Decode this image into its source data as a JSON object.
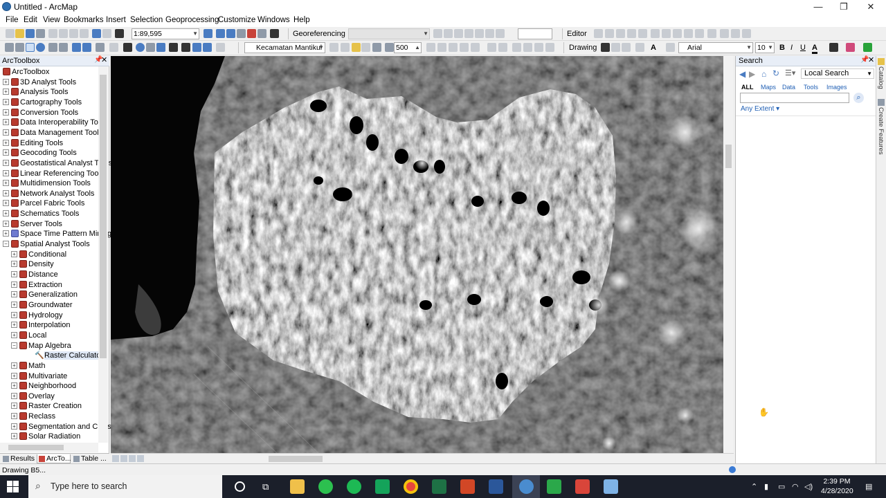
{
  "window": {
    "title": "Untitled - ArcMap",
    "minimize": "—",
    "maximize": "❐",
    "close": "✕"
  },
  "menu": [
    "File",
    "Edit",
    "View",
    "Bookmarks",
    "Insert",
    "Selection",
    "Geoprocessing",
    "Customize",
    "Windows",
    "Help"
  ],
  "toolbar": {
    "scale": "1:89,595",
    "georeferencing_label": "Georeferencing",
    "editor_label": "Editor",
    "layer_combo": "Kecamatan Mantikul",
    "resolution": "500",
    "drawing_label": "Drawing",
    "font_name": "Arial",
    "font_size": "10",
    "bold": "B",
    "italic": "I",
    "underline": "U",
    "font_color_label": "A"
  },
  "arctoolbox": {
    "title": "ArcToolbox",
    "root": "ArcToolbox",
    "toolboxes": [
      "3D Analyst Tools",
      "Analysis Tools",
      "Cartography Tools",
      "Conversion Tools",
      "Data Interoperability Tools",
      "Data Management Tools",
      "Editing Tools",
      "Geocoding Tools",
      "Geostatistical Analyst Tools",
      "Linear Referencing Tools",
      "Multidimension Tools",
      "Network Analyst Tools",
      "Parcel Fabric Tools",
      "Schematics Tools",
      "Server Tools",
      "Space Time Pattern Mining",
      "Spatial Analyst Tools"
    ],
    "spatial_analyst_toolsets": [
      "Conditional",
      "Density",
      "Distance",
      "Extraction",
      "Generalization",
      "Groundwater",
      "Hydrology",
      "Interpolation",
      "Local",
      "Map Algebra",
      "Math",
      "Multivariate",
      "Neighborhood",
      "Overlay",
      "Raster Creation",
      "Reclass",
      "Segmentation and Classification",
      "Solar Radiation"
    ],
    "map_algebra_tool": "Raster Calculator",
    "tabs": [
      "Results",
      "ArcTo...",
      "Table ..."
    ]
  },
  "search": {
    "title": "Search",
    "scope": "Local Search",
    "categories": [
      "ALL",
      "Maps",
      "Data",
      "Tools",
      "Images"
    ],
    "query": "",
    "extent": "Any Extent"
  },
  "right_dock": [
    "Catalog",
    "Create Features"
  ],
  "status": {
    "text": "Drawing B5..."
  },
  "taskbar": {
    "search_placeholder": "Type here to search",
    "time": "2:39 PM",
    "date": "4/28/2020",
    "apps": [
      "file-explorer",
      "whatsapp",
      "spotify",
      "app-green",
      "chrome",
      "excel",
      "powerpoint",
      "word",
      "arcmap",
      "camtasia-green",
      "camtasia-red",
      "arccatalog"
    ]
  },
  "colors": {
    "selection": "#dfe8f6",
    "link": "#1f5fb4",
    "taskbar": "#1b1f2a"
  }
}
